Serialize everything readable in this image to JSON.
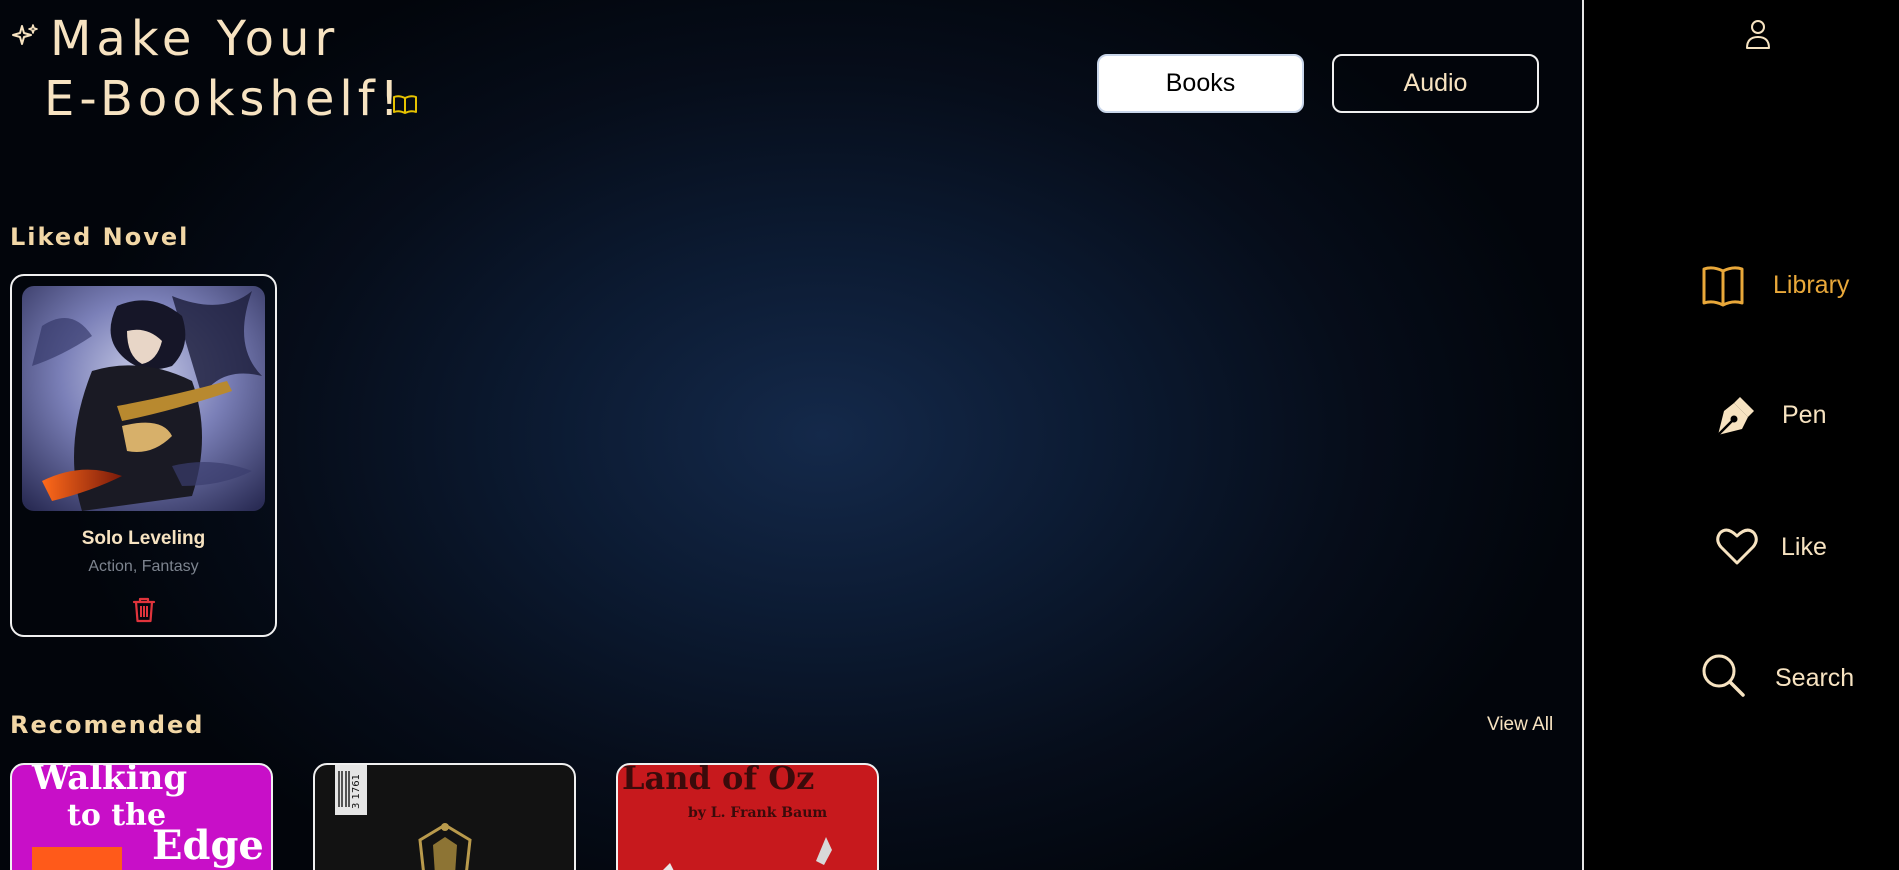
{
  "header": {
    "title_line1": "Make Your",
    "title_line2": "E-Bookshelf!",
    "sparkle_icon": "sparkles-icon",
    "book_icon": "open-book-icon"
  },
  "toggle": {
    "books_label": "Books",
    "audio_label": "Audio",
    "selected": "Books"
  },
  "liked": {
    "heading": "Liked Novel",
    "items": [
      {
        "title": "Solo Leveling",
        "genre": "Action, Fantasy",
        "delete_icon": "trash-icon"
      }
    ]
  },
  "recommended": {
    "heading": "Recomended",
    "view_all_label": "View All",
    "items": [
      {
        "cover_text_line1": "Walking",
        "cover_text_line2": "to the",
        "cover_text_line3": "Edge",
        "cover_color": "#c80fc8"
      },
      {
        "cover_text": "3 1761",
        "cover_color": "#121212"
      },
      {
        "cover_text_line1": "Land of Oz",
        "cover_text_line2": "by L. Frank Baum",
        "cover_color": "#c7191d"
      }
    ]
  },
  "sidebar": {
    "profile_icon": "user-icon",
    "items": [
      {
        "label": "Library",
        "icon": "book-icon",
        "active": true
      },
      {
        "label": "Pen",
        "icon": "pen-nib-icon",
        "active": false
      },
      {
        "label": "Like",
        "icon": "heart-icon",
        "active": false
      },
      {
        "label": "Search",
        "icon": "search-icon",
        "active": false
      }
    ]
  },
  "colors": {
    "accent": "#e9a83a",
    "cream": "#f7e3c1",
    "heading": "#f2d7a6",
    "danger": "#e0343c",
    "muted": "#7d848f"
  }
}
